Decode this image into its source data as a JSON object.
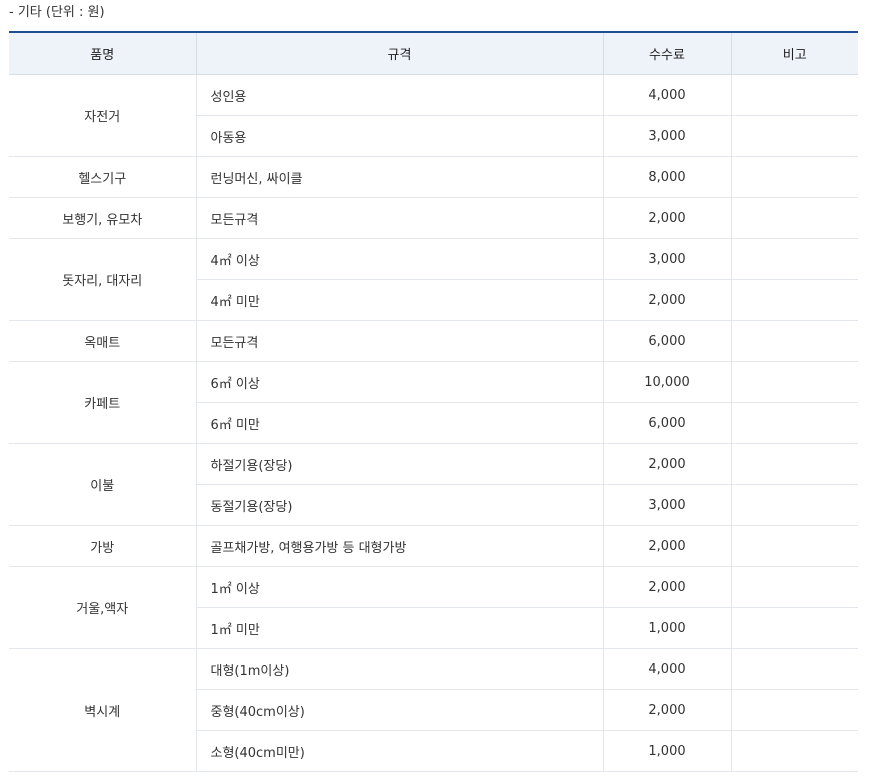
{
  "caption": "- 기타 (단위 : 원)",
  "headers": {
    "name": "품명",
    "spec": "규격",
    "fee": "수수료",
    "note": "비고"
  },
  "rows": [
    {
      "name": "자전거",
      "rowspan": 2,
      "spec": "성인용",
      "fee": "4,000"
    },
    {
      "spec": "아동용",
      "fee": "3,000"
    },
    {
      "name": "헬스기구",
      "rowspan": 1,
      "spec": "런닝머신, 싸이클",
      "fee": "8,000"
    },
    {
      "name": "보행기, 유모차",
      "rowspan": 1,
      "spec": "모든규격",
      "fee": "2,000"
    },
    {
      "name": "돗자리, 대자리",
      "rowspan": 2,
      "spec": "4㎡ 이상",
      "fee": "3,000"
    },
    {
      "spec": "4㎡ 미만",
      "fee": "2,000"
    },
    {
      "name": "옥매트",
      "rowspan": 1,
      "spec": "모든규격",
      "fee": "6,000"
    },
    {
      "name": "카페트",
      "rowspan": 2,
      "spec": "6㎡ 이상",
      "fee": "10,000"
    },
    {
      "spec": "6㎡ 미만",
      "fee": "6,000"
    },
    {
      "name": "이불",
      "rowspan": 2,
      "spec": "하절기용(장당)",
      "fee": "2,000"
    },
    {
      "spec": "동절기용(장당)",
      "fee": "3,000"
    },
    {
      "name": "가방",
      "rowspan": 1,
      "spec": "골프채가방, 여행용가방 등 대형가방",
      "fee": "2,000"
    },
    {
      "name": "거울,액자",
      "rowspan": 2,
      "spec": "1㎡ 이상",
      "fee": "2,000"
    },
    {
      "spec": "1㎡ 미만",
      "fee": "1,000"
    },
    {
      "name": "벽시계",
      "rowspan": 3,
      "spec": "대형(1m이상)",
      "fee": "4,000"
    },
    {
      "spec": "중형(40cm이상)",
      "fee": "2,000"
    },
    {
      "spec": "소형(40cm미만)",
      "fee": "1,000"
    }
  ]
}
